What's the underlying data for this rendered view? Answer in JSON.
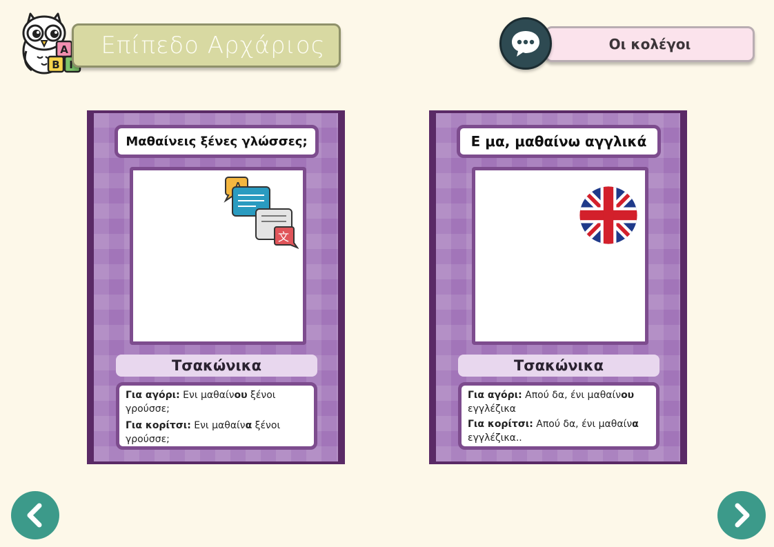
{
  "header": {
    "level_title": "Επίπεδο Αρχάριος",
    "colleagues_label": "Οι κολέγοι",
    "owl_blocks": [
      "Α",
      "Β",
      "Γ"
    ]
  },
  "cards": [
    {
      "title": "Μαθαίνεις ξένες γλώσσες;",
      "image_icon": "translate-icon",
      "translate_glyphs": [
        "A",
        "文"
      ],
      "language": "Τσακώνικα",
      "phrases": [
        {
          "label": "Για αγόρι:",
          "pre": " Ενι μαθαίν",
          "hi": "ου",
          "post": " ξένοι γρούσσε;"
        },
        {
          "label": "Για κορίτσι:",
          "pre": " Ενι μαθαίν",
          "hi": "α",
          "post": " ξένοι γρούσσε;"
        }
      ]
    },
    {
      "title": "Ε μα, μαθαίνω αγγλικά",
      "image_icon": "uk-flag-icon",
      "language": "Τσακώνικα",
      "phrases": [
        {
          "label": "Για αγόρι:",
          "pre": " Απού δα, ένι μαθαίν",
          "hi": "ου",
          "post": " εγγλέζικα"
        },
        {
          "label": "Για κορίτσι:",
          "pre": " Απού δα, ένι μαθαίν",
          "hi": "α",
          "post": " εγγλέζικα.."
        }
      ]
    }
  ],
  "colors": {
    "background": "#fdf8e9",
    "card_purple": "#a275b9",
    "card_border": "#5a2a66",
    "level_banner": "#d8d9a2",
    "colleague_banner": "#fbe3ec",
    "nav_teal": "#3c9a8a"
  }
}
